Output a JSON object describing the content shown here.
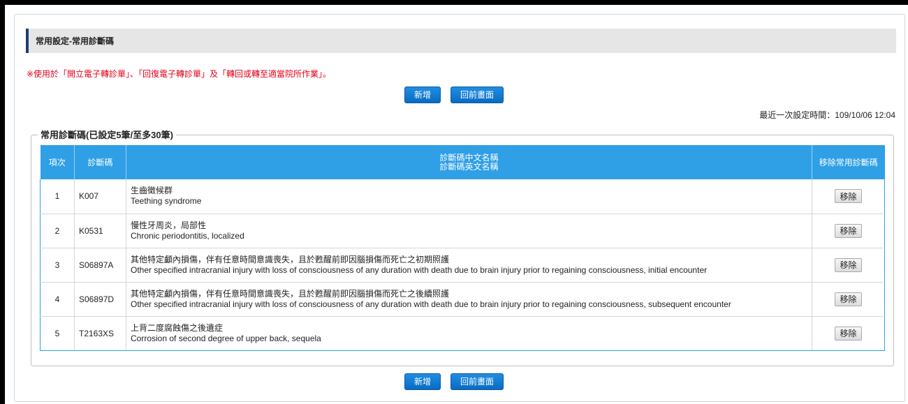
{
  "header": {
    "title": "常用設定-常用診斷碼"
  },
  "notice": "※使用於「開立電子轉診單」、「回復電子轉診單」及「轉回或轉至適當院所作業」。",
  "buttons": {
    "add": "新增",
    "back": "回前畫面"
  },
  "last_set": "最近一次設定時間：109/10/06 12:04",
  "section": {
    "legend": "常用診斷碼(已設定5筆/至多30筆)"
  },
  "table": {
    "headers": {
      "no": "項次",
      "code": "診斷碼",
      "name_zh": "診斷碼中文名稱",
      "name_en": "診斷碼英文名稱",
      "action": "移除常用診斷碼"
    },
    "remove_label": "移除",
    "rows": [
      {
        "no": "1",
        "code": "K007",
        "zh": "生齒徵候群",
        "en": "Teething syndrome"
      },
      {
        "no": "2",
        "code": "K0531",
        "zh": "慢性牙周炎，局部性",
        "en": "Chronic periodontitis, localized"
      },
      {
        "no": "3",
        "code": "S06897A",
        "zh": "其他特定顱內損傷，伴有任意時間意識喪失，且於甦醒前即因腦損傷而死亡之初期照護",
        "en": "Other specified intracranial injury with loss of consciousness of any duration with death due to brain injury prior to regaining consciousness, initial encounter"
      },
      {
        "no": "4",
        "code": "S06897D",
        "zh": "其他特定顱內損傷，伴有任意時間意識喪失，且於甦醒前即因腦損傷而死亡之後續照護",
        "en": "Other specified intracranial injury with loss of consciousness of any duration with death due to brain injury prior to regaining consciousness, subsequent encounter"
      },
      {
        "no": "5",
        "code": "T2163XS",
        "zh": "上背二度腐蝕傷之後遺症",
        "en": "Corrosion of second degree of upper back, sequela"
      }
    ]
  },
  "colors": {
    "header_bg": "#2f9fe6",
    "button_bg": "#0a6bc2",
    "notice": "#e3001b",
    "title_accent": "#1c3f73"
  }
}
